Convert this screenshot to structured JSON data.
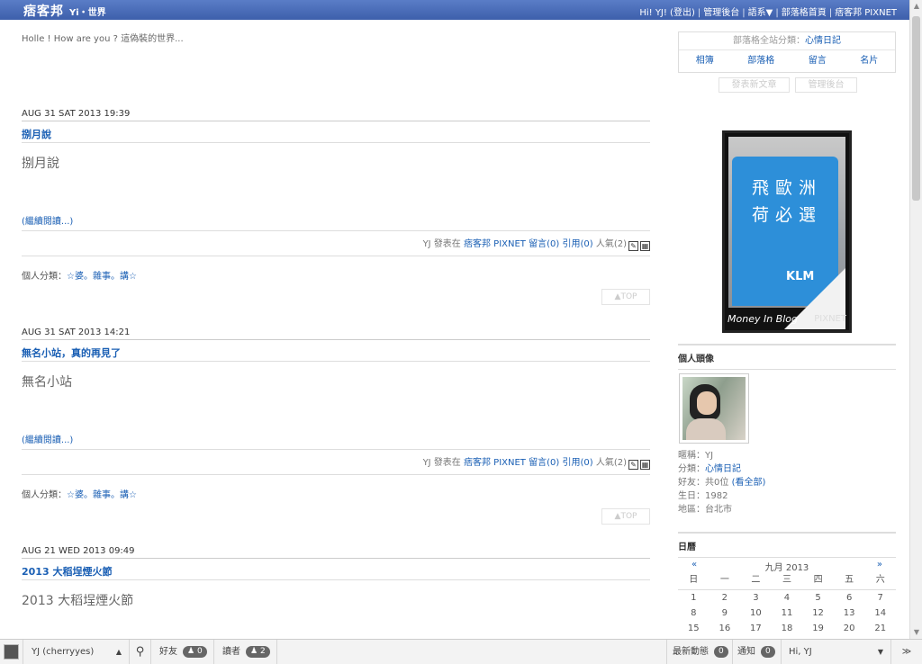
{
  "topbar": {
    "logo": "痞客邦",
    "blog_name": "Yi・世界",
    "links": [
      "Hi! YJ! (登出)",
      "管理後台",
      "語系▼",
      "部落格首頁",
      "痞客邦 PIXNET"
    ]
  },
  "blog_description": "Holle ! How are you ? 這偽裝的世界...",
  "posts": [
    {
      "date": "AUG 31 SAT 2013 19:39",
      "title": "捌月說",
      "body": "捌月說",
      "more": "(繼續閱讀...)",
      "meta_prefix": "YJ 發表在",
      "meta_site": "痞客邦 PIXNET",
      "meta_comments": "留言(0)",
      "meta_trackback": "引用(0)",
      "meta_views": "人氣(2)",
      "cat_label": "個人分類：",
      "cat_value": "☆婆。雜事。講☆",
      "top": "▲TOP"
    },
    {
      "date": "AUG 31 SAT 2013 14:21",
      "title": "無名小站，真的再見了",
      "body": "無名小站",
      "more": "(繼續閱讀...)",
      "meta_prefix": "YJ 發表在",
      "meta_site": "痞客邦 PIXNET",
      "meta_comments": "留言(0)",
      "meta_trackback": "引用(0)",
      "meta_views": "人氣(2)",
      "cat_label": "個人分類：",
      "cat_value": "☆婆。雜事。講☆",
      "top": "▲TOP"
    },
    {
      "date": "AUG 21 WED 2013 09:49",
      "title": "2013 大稻埕煙火節",
      "body": "2013 大稻埕煙火節"
    }
  ],
  "sidebar": {
    "category_label": "部落格全站分類：",
    "category_value": "心情日記",
    "nav": [
      "相簿",
      "部落格",
      "留言",
      "名片"
    ],
    "btn_new_post": "發表新文章",
    "btn_admin": "管理後台",
    "ad": {
      "line1": "飛歐洲",
      "line2": "荷必選",
      "brand": "KLM",
      "footer_left": "Money In Blog",
      "footer_right": "PIXNET"
    },
    "avatar_heading": "個人頭像",
    "profile": {
      "nick_label": "暱稱：",
      "nick": "YJ",
      "cat_label": "分類：",
      "cat": "心情日記",
      "friends_label": "好友：",
      "friends": "共0位",
      "friends_link": "(看全部)",
      "birth_label": "生日：",
      "birth": "1982",
      "area_label": "地區：",
      "area": "台北市"
    },
    "calendar_heading": "日曆",
    "calendar": {
      "prev": "«",
      "next": "»",
      "month": "九月 2013",
      "weekdays": [
        "日",
        "一",
        "二",
        "三",
        "四",
        "五",
        "六"
      ],
      "days": [
        "1",
        "2",
        "3",
        "4",
        "5",
        "6",
        "7",
        "8",
        "9",
        "10",
        "11",
        "12",
        "13",
        "14",
        "15",
        "16",
        "17",
        "18",
        "19",
        "20",
        "21"
      ]
    }
  },
  "bottombar": {
    "user": "YJ (cherryyes)",
    "friends_label": "好友",
    "friends_count": "0",
    "readers_label": "讀者",
    "readers_count": "2",
    "news_label": "最新動態",
    "news_count": "0",
    "notify_label": "通知",
    "notify_count": "0",
    "hi": "Hi, YJ"
  }
}
